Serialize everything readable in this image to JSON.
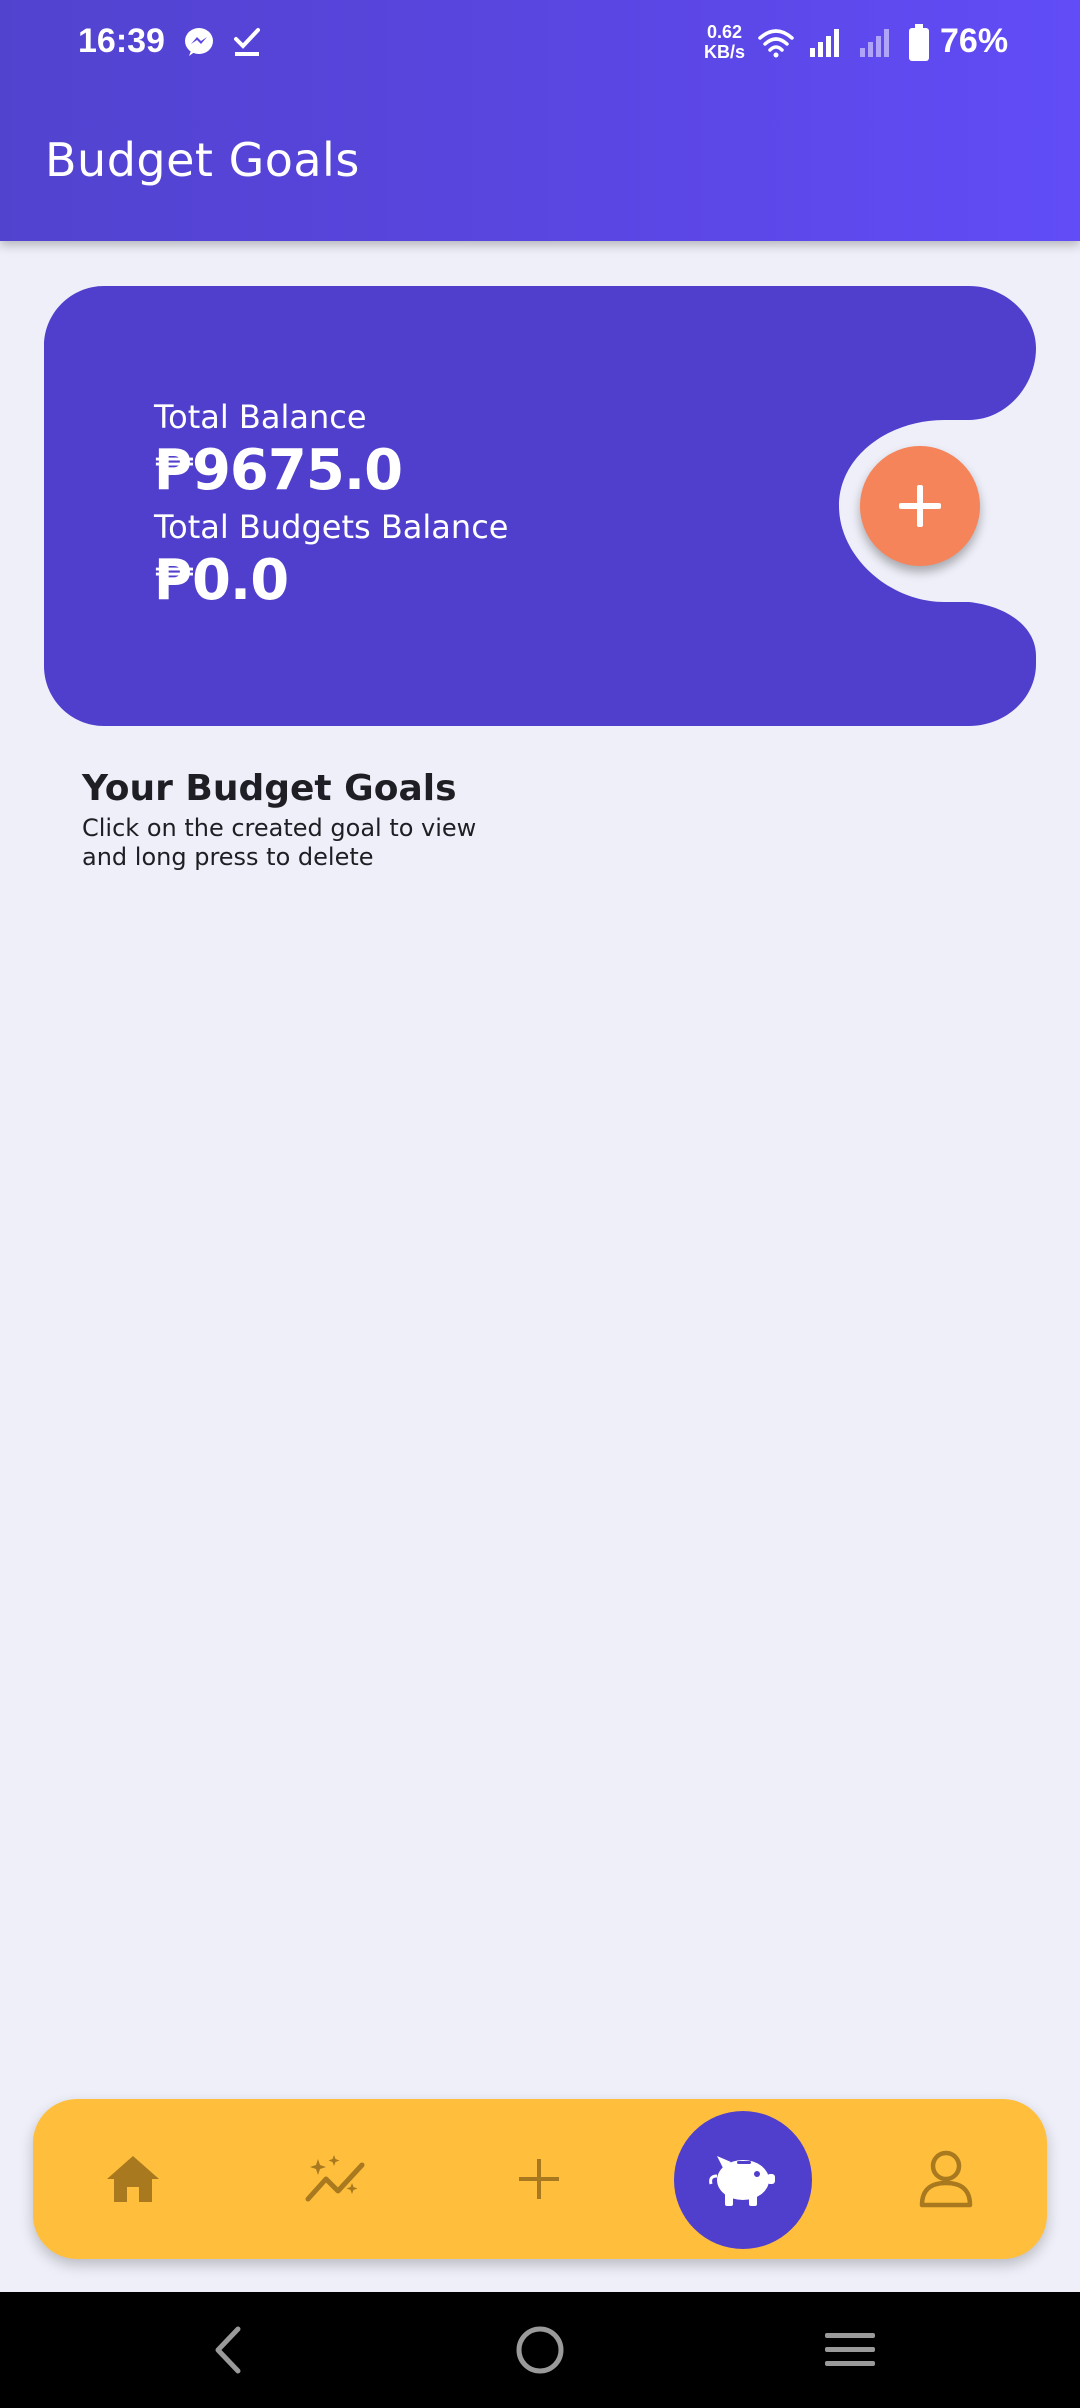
{
  "status_bar": {
    "time": "16:39",
    "net_speed_value": "0.62",
    "net_speed_unit": "KB/s",
    "battery_percent": "76%",
    "icons": [
      "messenger-icon",
      "check-icon",
      "wifi-icon",
      "signal-icon",
      "signal-weak-icon",
      "battery-icon"
    ]
  },
  "header": {
    "title": "Budget Goals"
  },
  "balance_card": {
    "total_balance_label": "Total Balance",
    "total_balance_value": "₱9675.0",
    "total_budgets_label": "Total Budgets Balance",
    "total_budgets_value": "₱0.0",
    "add_button_icon": "plus-icon"
  },
  "goals_section": {
    "title": "Your Budget Goals",
    "subtitle": "Click on the created goal to view and long press to delete"
  },
  "bottom_nav": {
    "items": [
      {
        "icon": "home-icon",
        "active": false
      },
      {
        "icon": "sparkle-chart-icon",
        "active": false
      },
      {
        "icon": "plus-icon",
        "active": false
      },
      {
        "icon": "piggy-bank-icon",
        "active": true
      },
      {
        "icon": "person-icon",
        "active": false
      }
    ]
  },
  "colors": {
    "header": "#5a46e2",
    "card": "#4f3fcc",
    "fab": "#f5845a",
    "nav_bar": "#ffbf3c",
    "nav_icon": "#a8791e",
    "background": "#efeff9"
  }
}
